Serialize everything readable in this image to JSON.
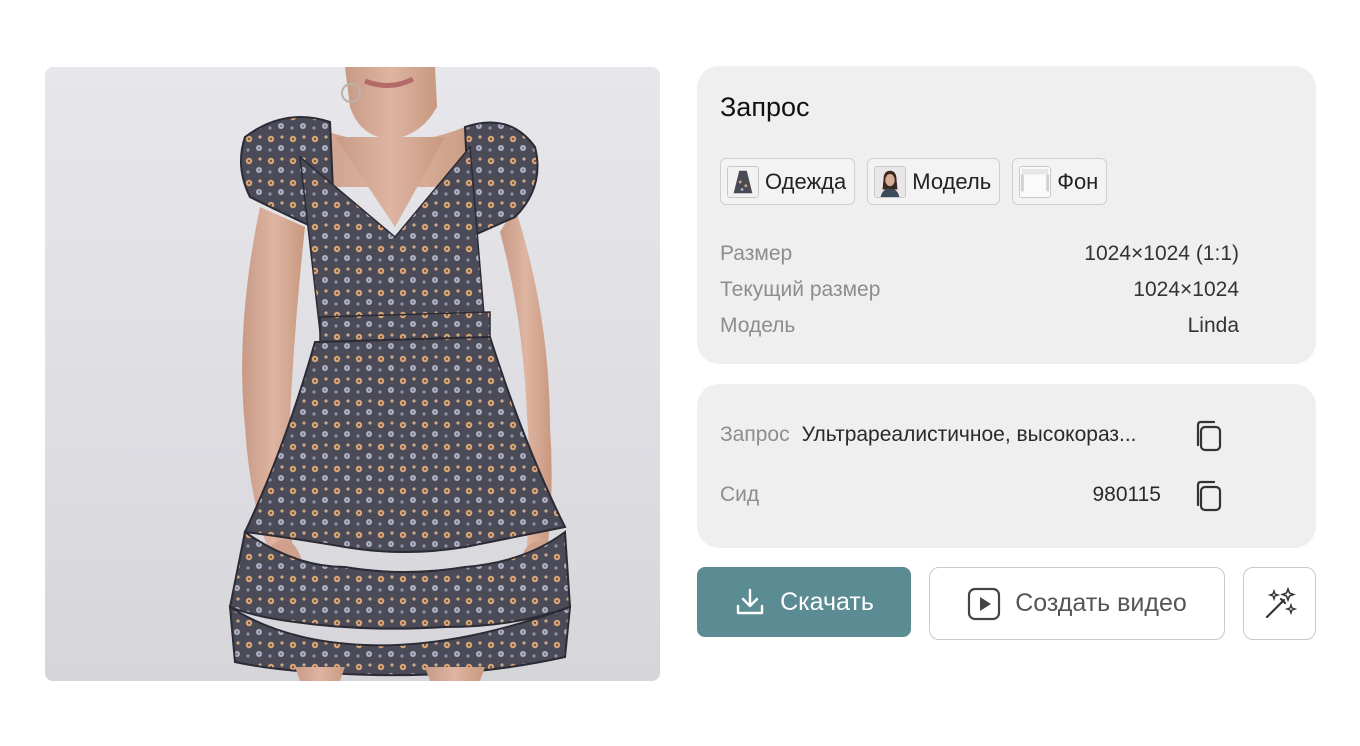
{
  "image": {
    "description_icon": "dress-photo"
  },
  "info": {
    "title": "Запрос",
    "chips": [
      {
        "label": "Одежда",
        "icon": "dress-thumb"
      },
      {
        "label": "Модель",
        "icon": "model-thumb"
      },
      {
        "label": "Фон",
        "icon": "background-thumb"
      }
    ],
    "rows": [
      {
        "key": "Размер",
        "value": "1024×1024 (1:1)"
      },
      {
        "key": "Текущий размер",
        "value": "1024×1024"
      },
      {
        "key": "Модель",
        "value": "Linda"
      }
    ]
  },
  "query": {
    "prompt_label": "Запрос",
    "prompt_value": "Ультрареалистичное, высокораз...",
    "seed_label": "Сид",
    "seed_value": "980115"
  },
  "actions": {
    "download": "Скачать",
    "create_video": "Создать видео"
  },
  "colors": {
    "accent": "#5b8b93",
    "card_bg": "#efefef"
  }
}
